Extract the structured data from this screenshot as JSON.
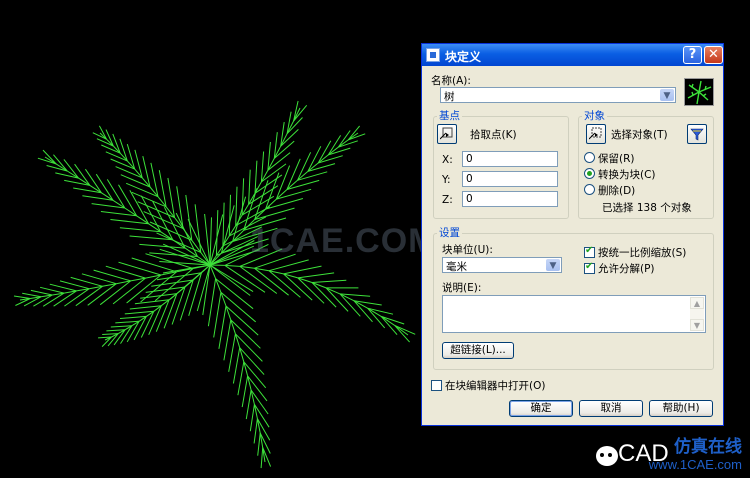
{
  "watermark": {
    "main": "1CAE.COM",
    "brand_cn": "仿真在线",
    "brand_en": "www.1CAE.com",
    "cad": "CAD"
  },
  "dialog": {
    "title": "块定义",
    "help_btn": "?",
    "close_btn": "✕",
    "name_label": "名称(A):",
    "name_value": "树",
    "base": {
      "title": "基点",
      "pick_label": "拾取点(K)",
      "x_label": "X:",
      "x_value": "0",
      "y_label": "Y:",
      "y_value": "0",
      "z_label": "Z:",
      "z_value": "0"
    },
    "objects": {
      "title": "对象",
      "select_label": "选择对象(T)",
      "retain": "保留(R)",
      "convert": "转换为块(C)",
      "delete": "删除(D)",
      "selected_count": "已选择 138 个对象"
    },
    "settings": {
      "title": "设置",
      "unit_label": "块单位(U):",
      "unit_value": "毫米",
      "uniform_scale": "按统一比例缩放(S)",
      "allow_explode": "允许分解(P)",
      "desc_label": "说明(E):",
      "hyperlink": "超链接(L)..."
    },
    "open_in_editor": "在块编辑器中打开(O)",
    "ok": "确定",
    "cancel": "取消",
    "help": "帮助(H)"
  }
}
